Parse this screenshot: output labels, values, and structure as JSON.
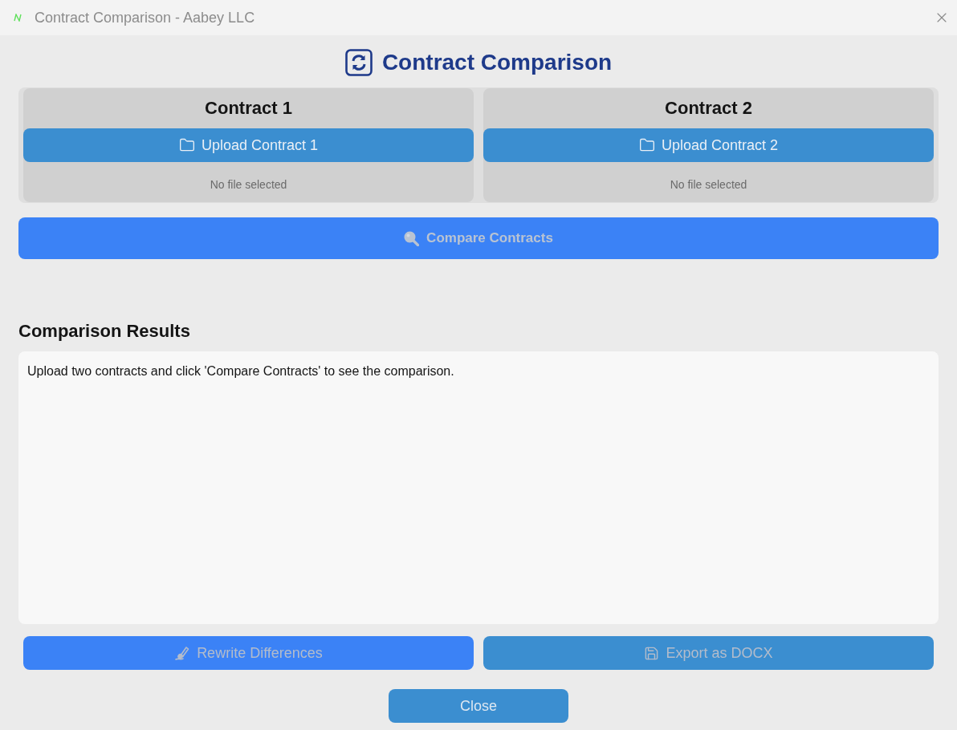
{
  "window": {
    "title": "Contract Comparison - Aabey LLC"
  },
  "heading": "Contract Comparison",
  "contracts": [
    {
      "title": "Contract 1",
      "upload_label": "Upload Contract 1",
      "file_status": "No file selected"
    },
    {
      "title": "Contract 2",
      "upload_label": "Upload Contract 2",
      "file_status": "No file selected"
    }
  ],
  "compare_button": {
    "label": "Compare Contracts",
    "disabled": true
  },
  "results": {
    "title": "Comparison Results",
    "text": "Upload two contracts and click 'Compare Contracts' to see the comparison."
  },
  "actions": [
    {
      "kind": "rewrite",
      "label": "Rewrite Differences",
      "disabled": true
    },
    {
      "kind": "export",
      "label": "Export as DOCX",
      "disabled": true
    }
  ],
  "close_button": {
    "label": "Close"
  }
}
